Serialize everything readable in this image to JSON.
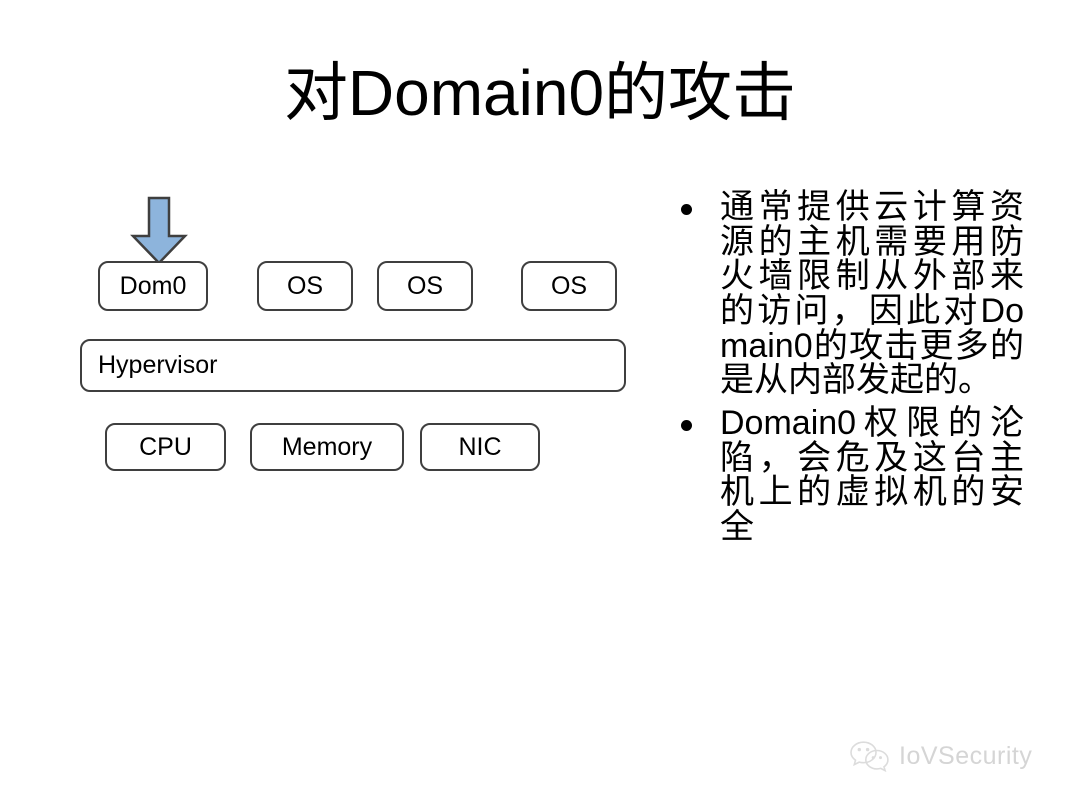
{
  "slide": {
    "title": "对Domain0的攻击",
    "background_color": "#ffffff"
  },
  "diagram": {
    "name": "xen-virtualization-stack",
    "arrow": {
      "icon": "arrow-down-icon",
      "fill_color": "#8db4dc",
      "stroke_color": "#3f3f3f",
      "points_to": "Dom0"
    },
    "guest_row": [
      {
        "id": "dom0",
        "label": "Dom0"
      },
      {
        "id": "os-1",
        "label": "OS"
      },
      {
        "id": "os-2",
        "label": "OS"
      },
      {
        "id": "os-3",
        "label": "OS"
      }
    ],
    "hypervisor": {
      "id": "hypervisor",
      "label": "Hypervisor"
    },
    "hardware_row": [
      {
        "id": "cpu",
        "label": "CPU"
      },
      {
        "id": "memory",
        "label": "Memory"
      },
      {
        "id": "nic",
        "label": "NIC"
      }
    ],
    "box_border_color": "#3f3f3f",
    "box_fill_color": "#ffffff"
  },
  "bullets": [
    {
      "marker": "•",
      "text": "通常提供云计算资源的主机需要用防火墙限制从外部来的访问，因此对Domain0的攻击更多的是从内部发起的。"
    },
    {
      "marker": "•",
      "text": "Domain0权限的沦陷，会危及这台主机上的虚拟机的安全"
    }
  ],
  "watermark": {
    "icon": "wechat-logo-icon",
    "label": "IoVSecurity",
    "color": "#d5d5d5"
  }
}
